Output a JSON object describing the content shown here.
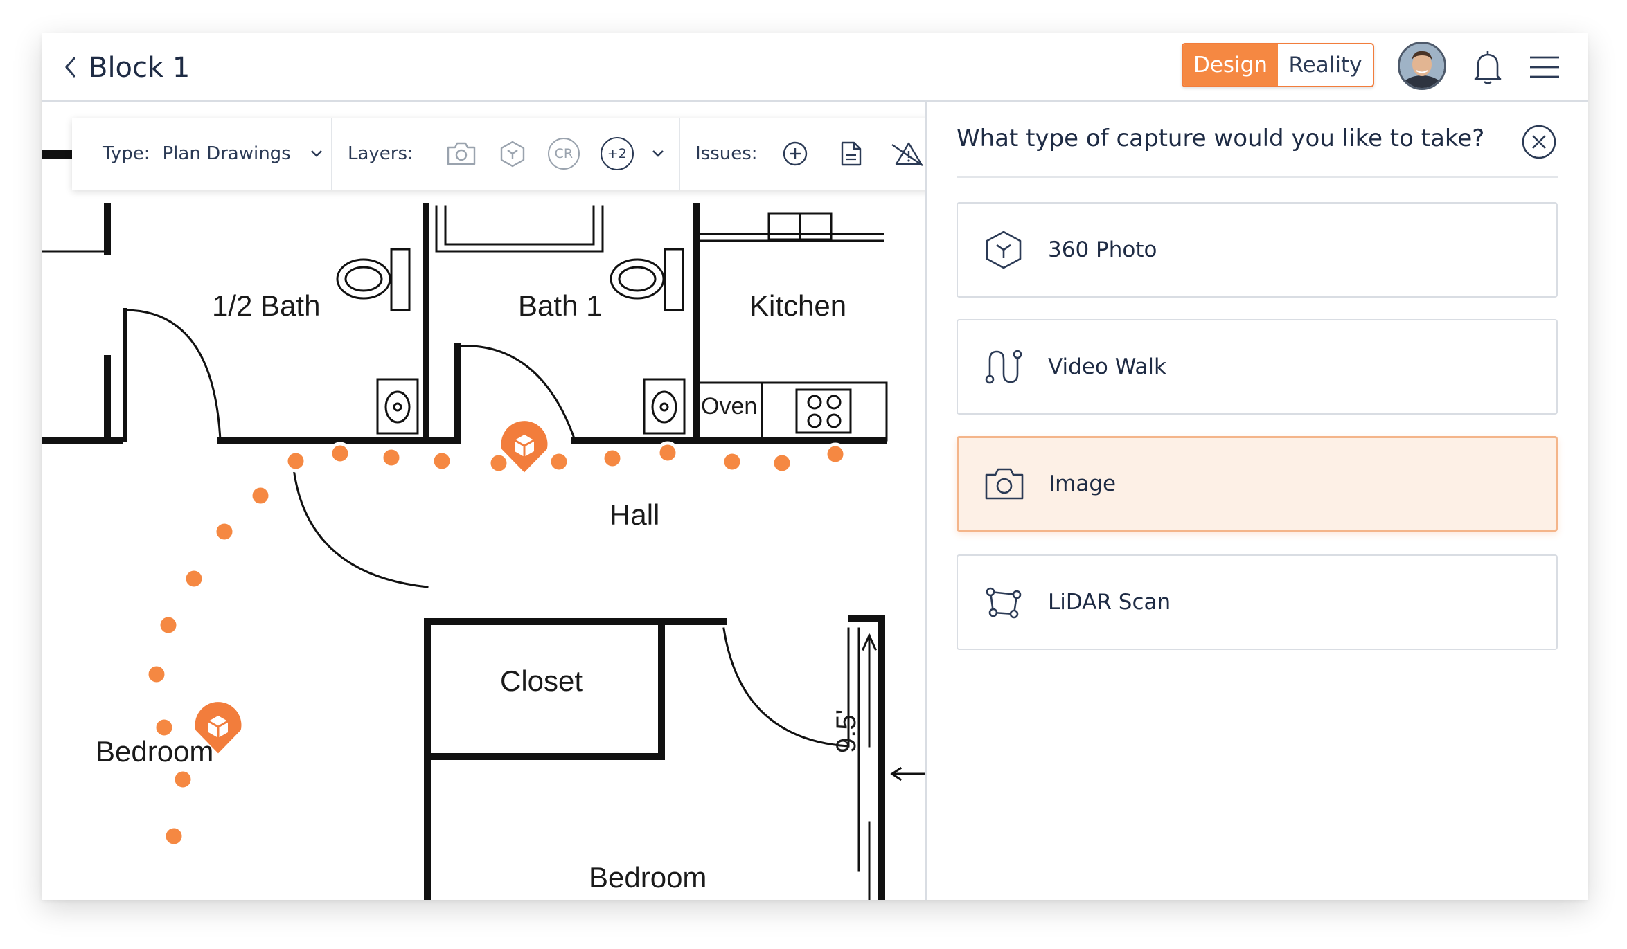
{
  "header": {
    "title": "Block 1",
    "toggle": {
      "design_label": "Design",
      "reality_label": "Reality",
      "active": "Design"
    }
  },
  "toolbar": {
    "type_label": "Type:",
    "type_value": "Plan Drawings",
    "layers_label": "Layers:",
    "layers_badges": [
      "CR",
      "+2"
    ],
    "issues_label": "Issues:"
  },
  "floorplan": {
    "rooms": [
      "1/2 Bath",
      "Bath 1",
      "Kitchen",
      "Oven",
      "Hall",
      "Closet",
      "Bedroom",
      "Bedroom",
      "9.5'"
    ]
  },
  "panel": {
    "question": "What type of capture would you like to take?",
    "options": [
      {
        "label": "360 Photo",
        "icon": "cube-360-icon",
        "selected": false
      },
      {
        "label": "Video Walk",
        "icon": "path-walk-icon",
        "selected": false
      },
      {
        "label": "Image",
        "icon": "camera-icon",
        "selected": true
      },
      {
        "label": "LiDAR Scan",
        "icon": "lidar-scan-icon",
        "selected": false
      }
    ]
  },
  "colors": {
    "accent": "#f58842",
    "accent_border": "#f27d3c",
    "selected_bg": "#fdf0e6",
    "text": "#1e2b44"
  }
}
